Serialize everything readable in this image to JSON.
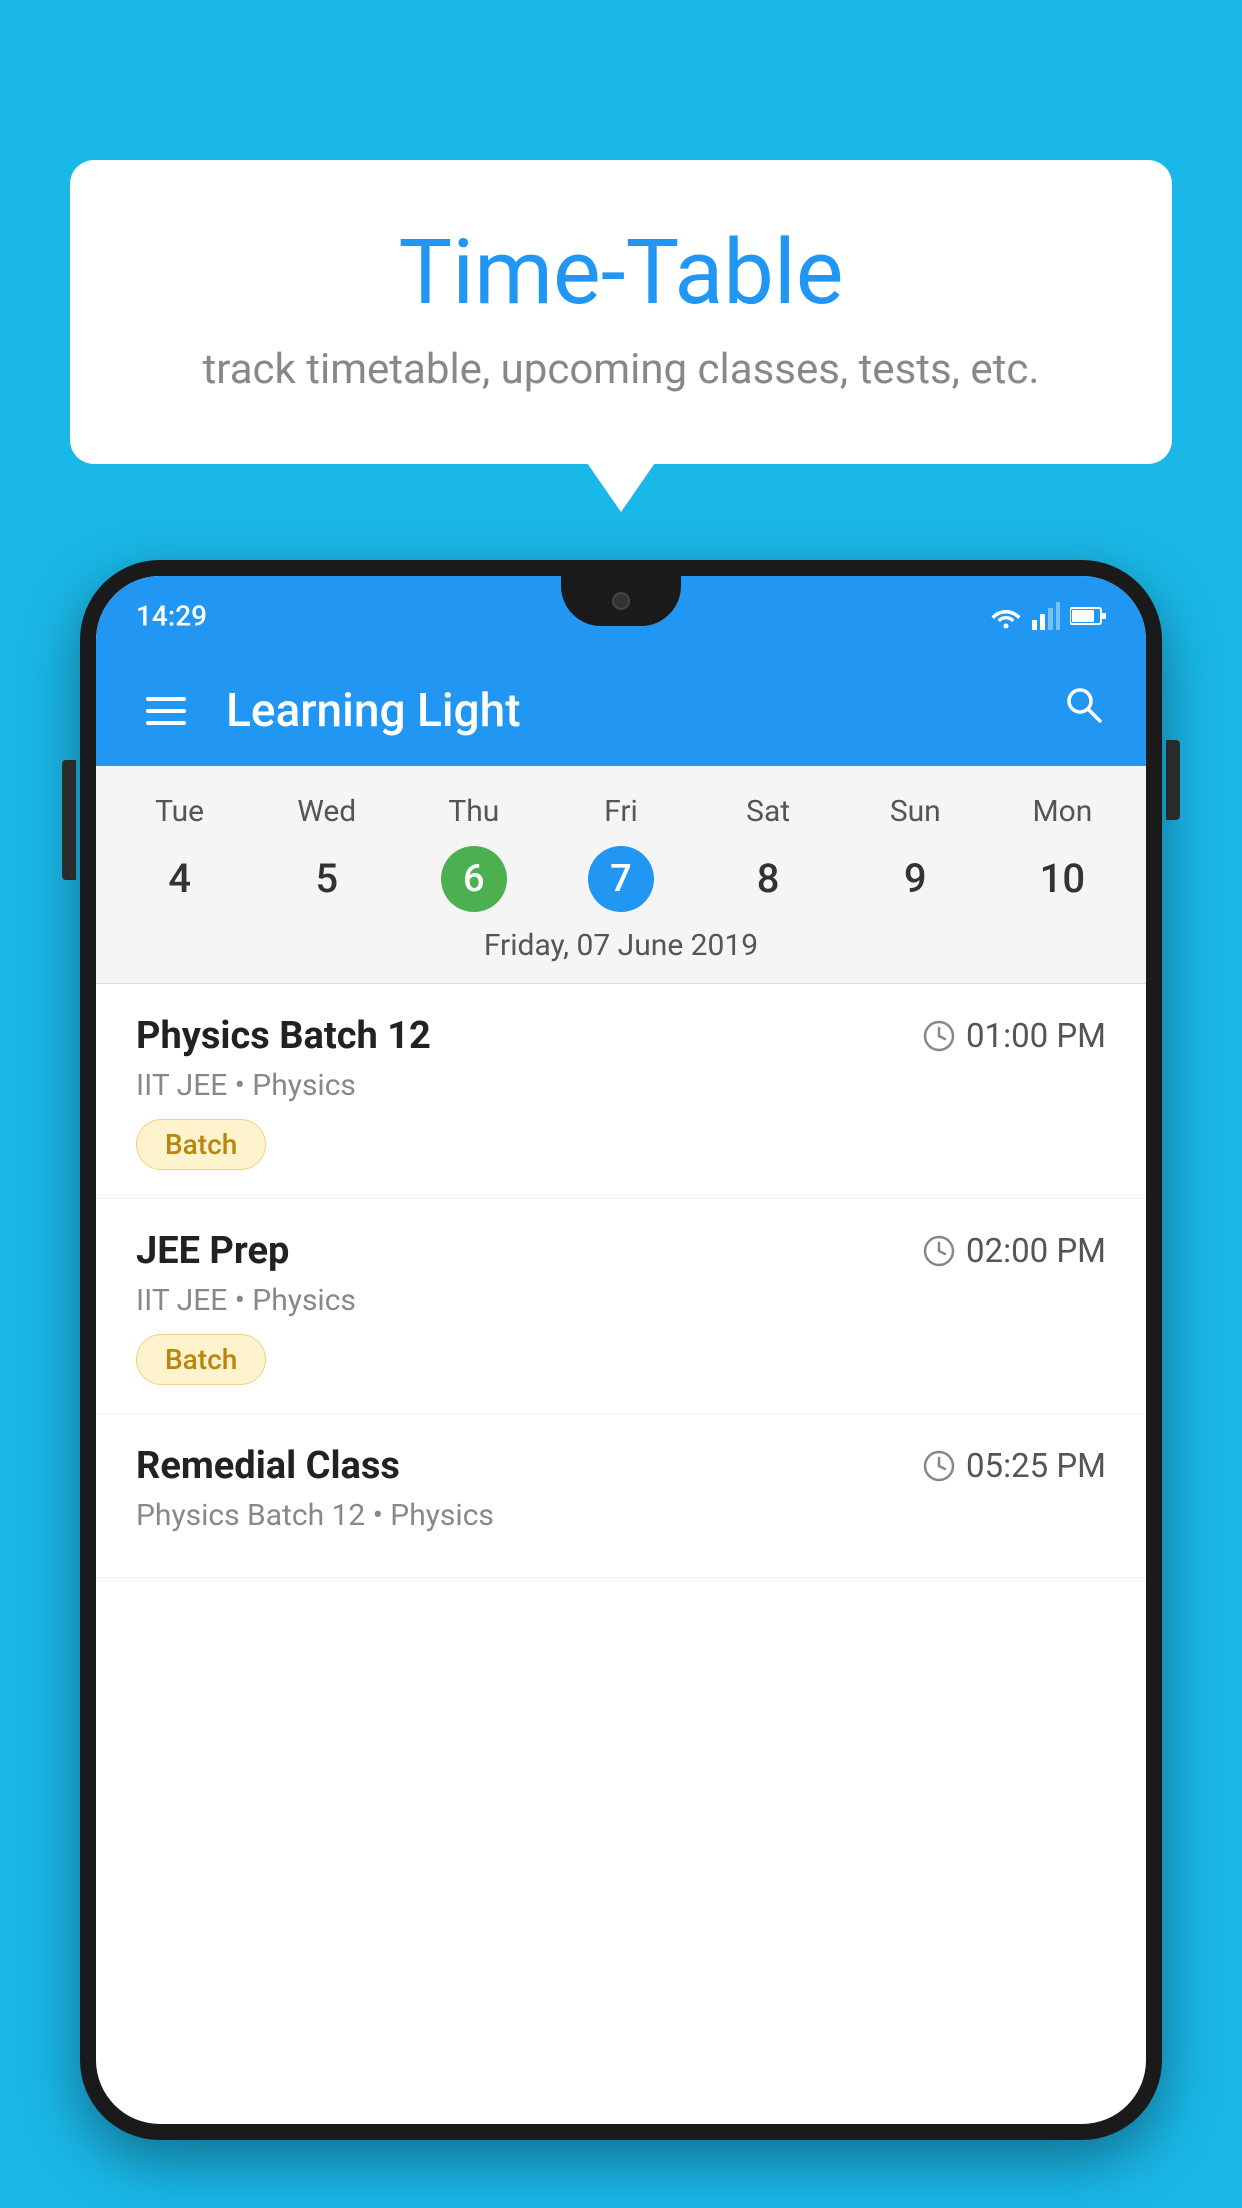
{
  "background_color": "#1ab8e8",
  "speech_bubble": {
    "title": "Time-Table",
    "subtitle": "track timetable, upcoming classes, tests, etc."
  },
  "phone": {
    "status_bar": {
      "time": "14:29"
    },
    "toolbar": {
      "title": "Learning Light"
    },
    "calendar": {
      "days": [
        {
          "label": "Tue",
          "number": "4"
        },
        {
          "label": "Wed",
          "number": "5"
        },
        {
          "label": "Thu",
          "number": "6",
          "state": "today"
        },
        {
          "label": "Fri",
          "number": "7",
          "state": "selected"
        },
        {
          "label": "Sat",
          "number": "8"
        },
        {
          "label": "Sun",
          "number": "9"
        },
        {
          "label": "Mon",
          "number": "10"
        }
      ],
      "selected_date_label": "Friday, 07 June 2019"
    },
    "classes": [
      {
        "name": "Physics Batch 12",
        "time": "01:00 PM",
        "subtitle": "IIT JEE • Physics",
        "tag": "Batch"
      },
      {
        "name": "JEE Prep",
        "time": "02:00 PM",
        "subtitle": "IIT JEE • Physics",
        "tag": "Batch"
      },
      {
        "name": "Remedial Class",
        "time": "05:25 PM",
        "subtitle": "Physics Batch 12 • Physics",
        "tag": ""
      }
    ]
  },
  "icons": {
    "menu": "☰",
    "search": "🔍",
    "clock": "⏱"
  }
}
